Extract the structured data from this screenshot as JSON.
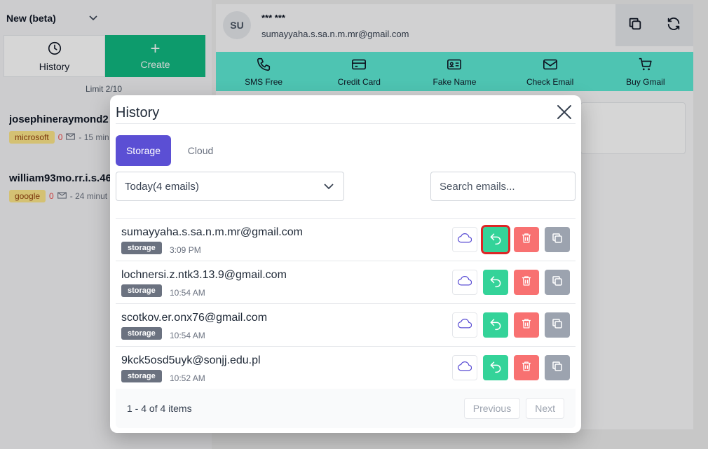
{
  "sidebar": {
    "mode_label": "New (beta)",
    "history_label": "History",
    "create_label": "Create",
    "create_symbol": "+",
    "limit_text": "Limit 2/10",
    "accounts": [
      {
        "address": "josephineraymond2",
        "provider": "microsoft",
        "count": "0",
        "age": "- 15 min"
      },
      {
        "address": "william93mo.rr.i.s.46",
        "provider": "google",
        "count": "0",
        "age": "- 24 minut"
      }
    ]
  },
  "account": {
    "initials": "SU",
    "name": "*** ***",
    "email": "sumayyaha.s.sa.n.m.mr@gmail.com"
  },
  "services": [
    {
      "label": "SMS Free",
      "icon": "phone-icon"
    },
    {
      "label": "Credit Card",
      "icon": "credit-card-icon"
    },
    {
      "label": "Fake Name",
      "icon": "id-card-icon"
    },
    {
      "label": "Check Email",
      "icon": "envelope-icon"
    },
    {
      "label": "Buy Gmail",
      "icon": "cart-icon"
    }
  ],
  "modal": {
    "title": "History",
    "tabs": {
      "storage": "Storage",
      "cloud": "Cloud"
    },
    "date_filter": "Today(4 emails)",
    "search_placeholder": "Search emails...",
    "rows": [
      {
        "email": "sumayyaha.s.sa.n.m.mr@gmail.com",
        "badge": "storage",
        "time": "3:09 PM"
      },
      {
        "email": "lochnersi.z.ntk3.13.9@gmail.com",
        "badge": "storage",
        "time": "10:54 AM"
      },
      {
        "email": "scotkov.er.onx76@gmail.com",
        "badge": "storage",
        "time": "10:54 AM"
      },
      {
        "email": "9kck5osd5uyk@sonjj.edu.pl",
        "badge": "storage",
        "time": "10:52 AM"
      }
    ],
    "pagination": {
      "range": "1 - 4 of 4 items",
      "previous": "Previous",
      "next": "Next"
    }
  },
  "colors": {
    "primary": "#5b4fd4",
    "create_green": "#10b981",
    "teal": "#5eead4",
    "restore": "#34d399",
    "delete": "#f87171",
    "copy": "#9ca3af",
    "highlight": "#dc2626"
  }
}
